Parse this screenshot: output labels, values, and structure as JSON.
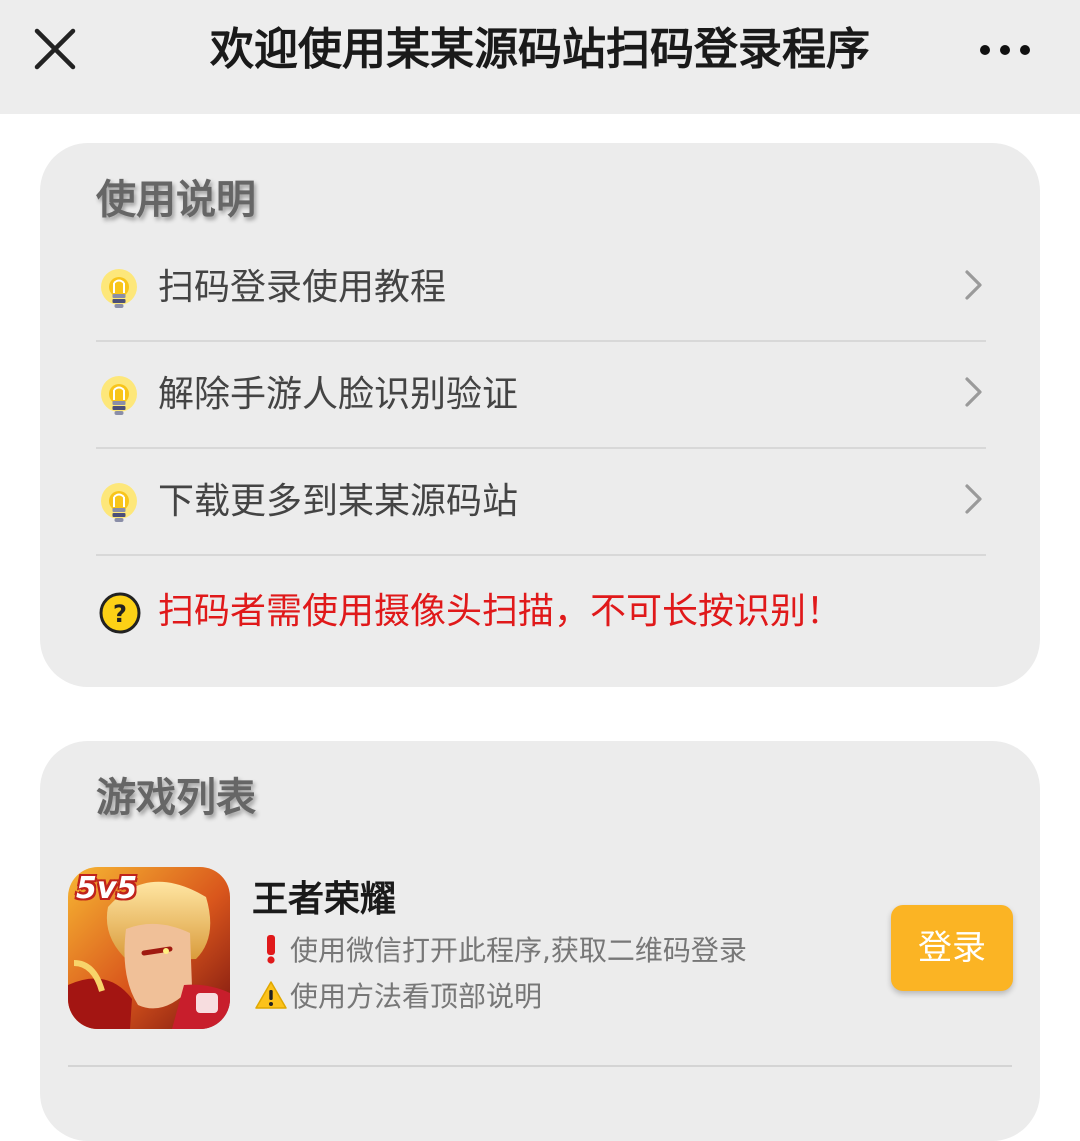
{
  "header": {
    "title": "欢迎使用某某源码站扫码登录程序",
    "close_icon": "close-icon",
    "more_icon": "more-dots-icon"
  },
  "guide": {
    "title": "使用说明",
    "items": [
      {
        "label": "扫码登录使用教程",
        "icon": "lightbulb-icon"
      },
      {
        "label": "解除手游人脸识别验证",
        "icon": "lightbulb-icon"
      },
      {
        "label": "下载更多到某某源码站",
        "icon": "lightbulb-icon"
      }
    ],
    "warning": "扫码者需使用摄像头扫描，不可长按识别！",
    "warning_icon": "question-circle-icon"
  },
  "games": {
    "title": "游戏列表",
    "items": [
      {
        "name": "王者荣耀",
        "badge": "5v5",
        "line1": "使用微信打开此程序,获取二维码登录",
        "line2": "使用方法看顶部说明",
        "button": "登录"
      }
    ]
  },
  "colors": {
    "header_bg": "#ededed",
    "card_bg": "#ececec",
    "warning_text": "#e0191a",
    "login_button": "#fbb424"
  }
}
